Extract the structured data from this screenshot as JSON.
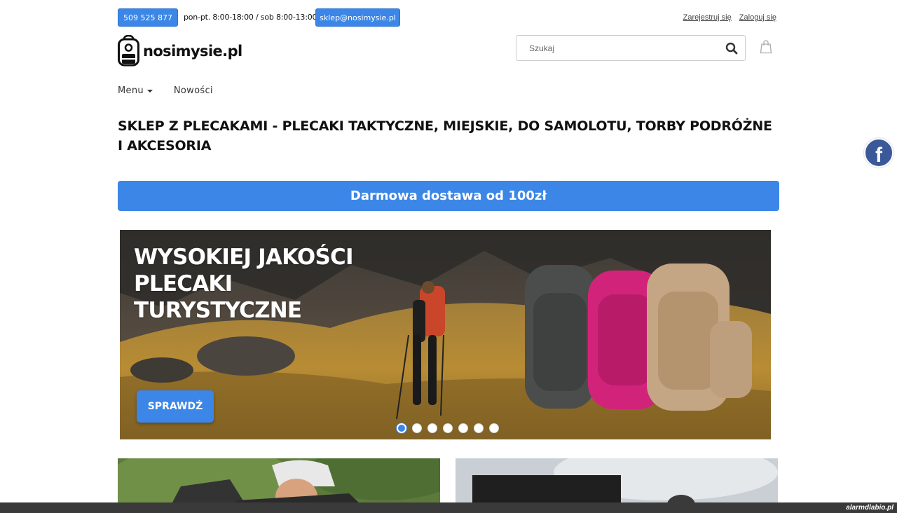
{
  "topbar": {
    "phone": "509 525 877",
    "hours": "pon-pt. 8:00-18:00 / sob 8:00-13:00",
    "email": "sklep@nosimysie.pl",
    "register": "Zarejestruj się",
    "login": "Zaloguj się"
  },
  "header": {
    "logo_text": "nosimysie.pl",
    "search_placeholder": "Szukaj",
    "icons": [
      "backpack-logo-icon",
      "search-icon",
      "shopping-bag-icon"
    ]
  },
  "nav": {
    "items": [
      {
        "label": "Menu",
        "dropdown": true
      },
      {
        "label": "Nowości",
        "dropdown": false
      }
    ]
  },
  "main": {
    "headline": "SKLEP Z PLECAKAMI  - PLECAKI TAKTYCZNE, MIEJSKIE, DO SAMOLOTU, TORBY PODRÓŻNE I AKCESORIA",
    "shipping_banner": "Darmowa dostawa od 100zł"
  },
  "slider": {
    "title_lines": [
      "WYSOKIEJ JAKOŚCI",
      "PLECAKI",
      "TURYSTYCZNE"
    ],
    "button": "SPRAWDŹ",
    "slide_count": 7,
    "active_slide": 1
  },
  "social": {
    "facebook_glyph": "f"
  },
  "watermark": "alarmdlabio.pl",
  "colors": {
    "accent": "#3b86e6",
    "facebook": "#3b5998"
  }
}
